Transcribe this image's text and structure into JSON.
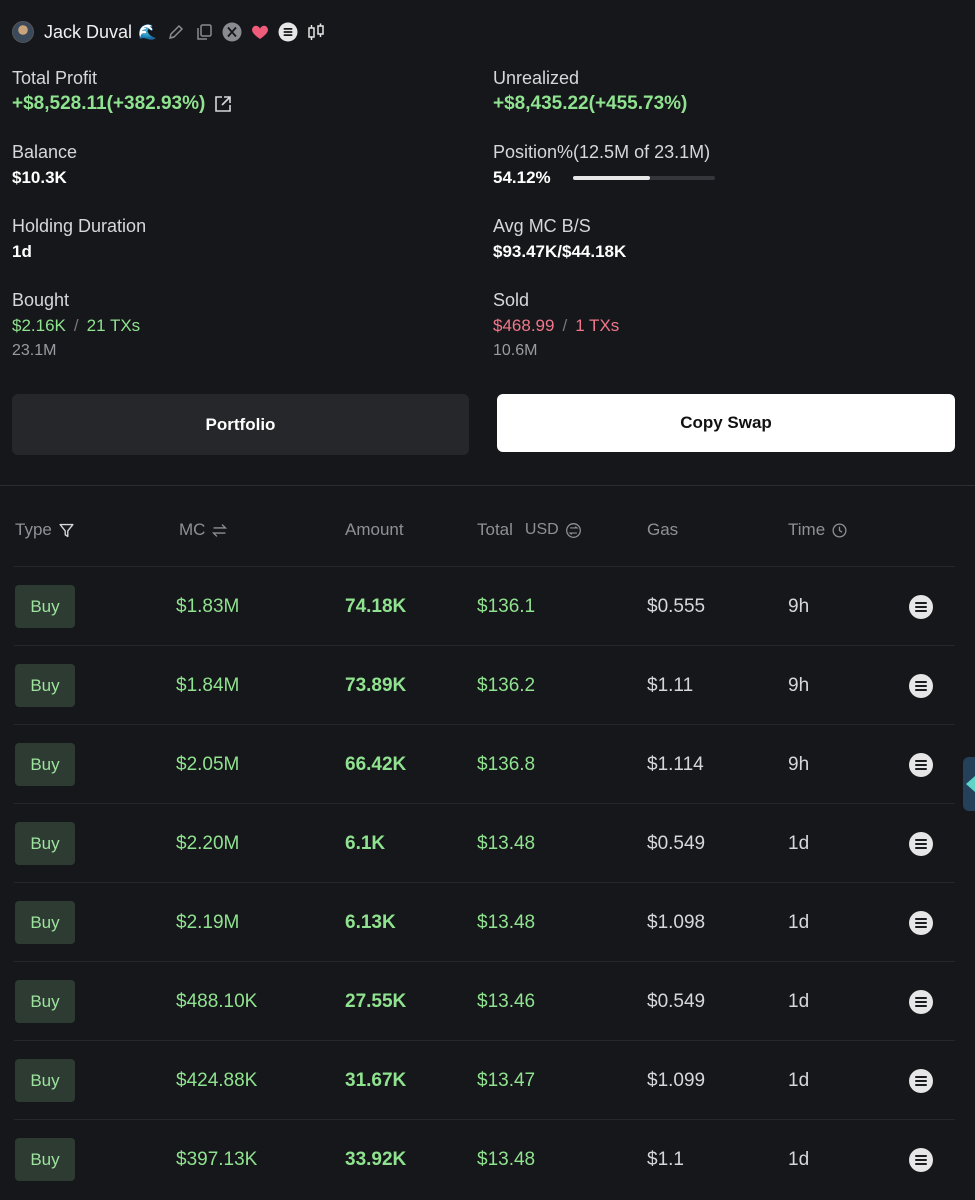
{
  "header": {
    "name": "Jack Duval",
    "wave": "🌊"
  },
  "stats": {
    "total_profit": {
      "label": "Total Profit",
      "value": "+$8,528.11(+382.93%)"
    },
    "unrealized": {
      "label": "Unrealized",
      "value": "+$8,435.22(+455.73%)"
    },
    "balance": {
      "label": "Balance",
      "value": "$10.3K"
    },
    "position": {
      "label": "Position%(12.5M of 23.1M)",
      "value": "54.12%",
      "fraction": 0.5412
    },
    "holding": {
      "label": "Holding Duration",
      "value": "1d"
    },
    "avg_mc": {
      "label": "Avg MC B/S",
      "value": "$93.47K/$44.18K"
    },
    "bought": {
      "label": "Bought",
      "usd": "$2.16K",
      "sep": "/",
      "txs": "21 TXs",
      "amount": "23.1M"
    },
    "sold": {
      "label": "Sold",
      "usd": "$468.99",
      "sep": "/",
      "txs": "1 TXs",
      "amount": "10.6M"
    }
  },
  "buttons": {
    "portfolio": "Portfolio",
    "copy_swap": "Copy Swap"
  },
  "table": {
    "headers": {
      "type": "Type",
      "mc": "MC",
      "amount": "Amount",
      "total": "Total",
      "usd": "USD",
      "gas": "Gas",
      "time": "Time"
    },
    "rows": [
      {
        "type": "Buy",
        "mc": "$1.83M",
        "amount": "74.18K",
        "total": "$136.1",
        "gas": "$0.555",
        "time": "9h"
      },
      {
        "type": "Buy",
        "mc": "$1.84M",
        "amount": "73.89K",
        "total": "$136.2",
        "gas": "$1.11",
        "time": "9h"
      },
      {
        "type": "Buy",
        "mc": "$2.05M",
        "amount": "66.42K",
        "total": "$136.8",
        "gas": "$1.114",
        "time": "9h"
      },
      {
        "type": "Buy",
        "mc": "$2.20M",
        "amount": "6.1K",
        "total": "$13.48",
        "gas": "$0.549",
        "time": "1d"
      },
      {
        "type": "Buy",
        "mc": "$2.19M",
        "amount": "6.13K",
        "total": "$13.48",
        "gas": "$1.098",
        "time": "1d"
      },
      {
        "type": "Buy",
        "mc": "$488.10K",
        "amount": "27.55K",
        "total": "$13.46",
        "gas": "$0.549",
        "time": "1d"
      },
      {
        "type": "Buy",
        "mc": "$424.88K",
        "amount": "31.67K",
        "total": "$13.47",
        "gas": "$1.099",
        "time": "1d"
      },
      {
        "type": "Buy",
        "mc": "$397.13K",
        "amount": "33.92K",
        "total": "$13.48",
        "gas": "$1.1",
        "time": "1d"
      }
    ]
  },
  "colors": {
    "positive": "#8fe28f",
    "negative": "#f0788a",
    "background": "#16171a"
  }
}
